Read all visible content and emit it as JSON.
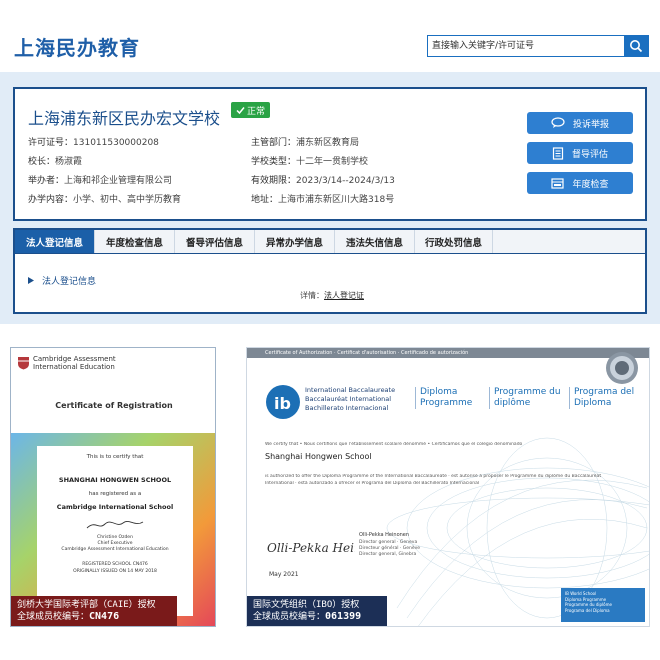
{
  "header": {
    "logo": "上海民办教育",
    "search_placeholder": "直接输入关键字/许可证号"
  },
  "school": {
    "name": "上海浦东新区民办宏文学校",
    "status": "正常",
    "fields": [
      {
        "label": "许可证号：",
        "value": "131011530000208"
      },
      {
        "label": "主管部门：",
        "value": "浦东新区教育局"
      },
      {
        "label": "校长：",
        "value": "杨淑霞"
      },
      {
        "label": "学校类型：",
        "value": "十二年一贯制学校"
      },
      {
        "label": "举办者：",
        "value": "上海和祁企业管理有限公司"
      },
      {
        "label": "有效期限：",
        "value": "2023/3/14--2024/3/13"
      },
      {
        "label": "办学内容：",
        "value": "小学、初中、高中学历教育"
      },
      {
        "label": "地址：",
        "value": "上海市浦东新区川大路318号"
      }
    ],
    "actions": [
      "投诉举报",
      "督导评估",
      "年度检查"
    ]
  },
  "tabs": [
    "法人登记信息",
    "年度检查信息",
    "督导评估信息",
    "异常办学信息",
    "违法失信信息",
    "行政处罚信息"
  ],
  "active_tab": "法人登记信息",
  "section": {
    "title": "法人登记信息",
    "detail_label": "详情：",
    "detail_link": "法人登记证"
  },
  "cert_cambridge": {
    "org_line1": "Cambridge Assessment",
    "org_line2": "International Education",
    "title": "Certificate of Registration",
    "certify": "This is to certify that",
    "school": "SHANGHAI HONGWEN SCHOOL",
    "registered": "has registered as a",
    "type": "Cambridge International School",
    "signer": "Christine Ozden",
    "signer_title": "Chief Executive",
    "signer_org": "Cambridge Assessment International Education",
    "reg_no": "REGISTERED SCHOOL CN476",
    "issued": "ORIGINALLY ISSUED ON 14 MAY 2018",
    "caption1": "剑桥大学国际考评部（CAIE）授权",
    "caption2_label": "全球成员校编号：",
    "caption2_value": "CN476"
  },
  "cert_ib": {
    "stripe": "Certificate of Authorization · Certificat d'autorisation · Certificado de autorización",
    "org1": "International Baccalaureate",
    "org2": "Baccalauréat International",
    "org3": "Bachillerato Internacional",
    "prog1a": "Diploma",
    "prog1b": "Programme",
    "prog2a": "Programme du",
    "prog2b": "diplôme",
    "prog3a": "Programa del",
    "prog3b": "Diploma",
    "certify": "We certify that • Nous certifions que l'établissement scolaire dénommé • Certificamos que el colegio denominado",
    "school": "Shanghai Hongwen School",
    "auth1": "is authorized to offer the Diploma Programme of the International Baccalaureate · est autorisé à proposer le Programme du diplôme du Baccalauréat",
    "auth2": "International · está autorizado a ofrecer el Programa del Diploma del Bachillerato Internacional",
    "signer": "Olli-Pekka Heinonen",
    "signer_t1": "Director general · Geneva",
    "signer_t2": "Directeur général · Genève",
    "signer_t3": "Director general, Ginebra",
    "signature": "Olli-Pekka Heinonen",
    "date": "May 2021",
    "caption1": "国际文凭组织（IBO）授权",
    "caption2_label": "全球成员校编号：",
    "caption2_value": "061399",
    "badge1": "IB World School",
    "badge2": "Diploma Programme",
    "badge3": "Programme du diplôme",
    "badge4": "Programa del Diploma"
  },
  "colors": {
    "brand": "#1f5fa8",
    "status_green": "#2aa345",
    "action_blue": "#2e7fd1"
  }
}
